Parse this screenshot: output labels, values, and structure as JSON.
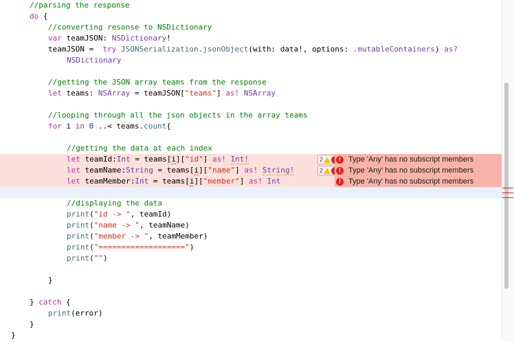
{
  "lines": {
    "l1": "//parsing the response",
    "l2_kw": "do",
    "l2_rest": " {",
    "l3": "//converting resonse to NSDictionary",
    "l4_kw": "var",
    "l4_a": " teamJSON: ",
    "l4_ty": "NSDictionary",
    "l4_b": "!",
    "l5_a": "teamJSON = ",
    "l5_kw": "try",
    "l5_fn": " JSONSerialization.jsonObject",
    "l5_b": "(with: data!, options: ",
    "l5_enum": ".mutableContainers",
    "l5_c": ") ",
    "l5_as": "as?",
    "l6_ty": "NSDictionary",
    "l7": "//getting the JSON array teams from the response",
    "l8_kw": "let",
    "l8_a": " teams: ",
    "l8_ty": "NSArray",
    "l8_b": " = teamJSON[",
    "l8_str": "\"teams\"",
    "l8_c": "] ",
    "l8_as": "as!",
    "l8_ty2": " NSArray",
    "l9": "//looping through all the json objects in the array teams",
    "l10_kw": "for",
    "l10_a": " i ",
    "l10_in": "in",
    "l10_num": " 0",
    "l10_b": " ..< teams.",
    "l10_fn": "count",
    "l10_c": "{",
    "l11": "//getting the data at each index",
    "l12_kw": "let",
    "l12_a": " teamId:",
    "l12_ty": "Int",
    "l12_b": " = teams[",
    "l12_i": "i",
    "l12_c": "][",
    "l12_str": "\"id\"",
    "l12_d": "] ",
    "l12_as": "as!",
    "l12_e": " ",
    "l12_ty2": "Int!",
    "l13_kw": "let",
    "l13_a": " teamName:",
    "l13_ty": "String",
    "l13_b": " = teams[",
    "l13_i": "i",
    "l13_c": "][",
    "l13_str": "\"name\"",
    "l13_d": "] ",
    "l13_as": "as!",
    "l13_e": " ",
    "l13_ty2": "String!",
    "l14_kw": "let",
    "l14_a": " teamMember:",
    "l14_ty": "Int",
    "l14_b": " = teams[",
    "l14_i": "i",
    "l14_c": "][",
    "l14_str": "\"member\"",
    "l14_d": "] ",
    "l14_as": "as!",
    "l14_ty2": " Int",
    "l15": "//displaying the data",
    "l16_fn": "print",
    "l16_a": "(",
    "l16_str": "\"id -> \"",
    "l16_b": ", teamId)",
    "l17_fn": "print",
    "l17_a": "(",
    "l17_str": "\"name -> \"",
    "l17_b": ", teamName)",
    "l18_fn": "print",
    "l18_a": "(",
    "l18_str": "\"member -> \"",
    "l18_b": ", teamMember)",
    "l19_fn": "print",
    "l19_a": "(",
    "l19_str": "\"===================\"",
    "l19_b": ")",
    "l20_fn": "print",
    "l20_a": "(",
    "l20_str": "\"\"",
    "l20_b": ")",
    "l21": "}",
    "l22_a": "} ",
    "l22_kw": "catch",
    "l22_b": " {",
    "l23_fn": "print",
    "l23_a": "(error)",
    "l24": "}",
    "l25": "}"
  },
  "issues": [
    {
      "count": "2",
      "message": "Type 'Any' has no subscript members"
    },
    {
      "count": "2",
      "message": "Type 'Any' has no subscript members"
    },
    {
      "count": "",
      "message": "Type 'Any' has no subscript members"
    }
  ],
  "colors": {
    "comment": "#008400",
    "keyword": "#ba2da2",
    "type": "#703daa",
    "string": "#d12f1b",
    "number": "#272ad8",
    "error_line_bg": "#fbe0db",
    "error_message_bg": "#f8b4a8",
    "current_line_bg": "#e8f2ff"
  },
  "icons": [
    "warning-icon",
    "error-icon"
  ]
}
